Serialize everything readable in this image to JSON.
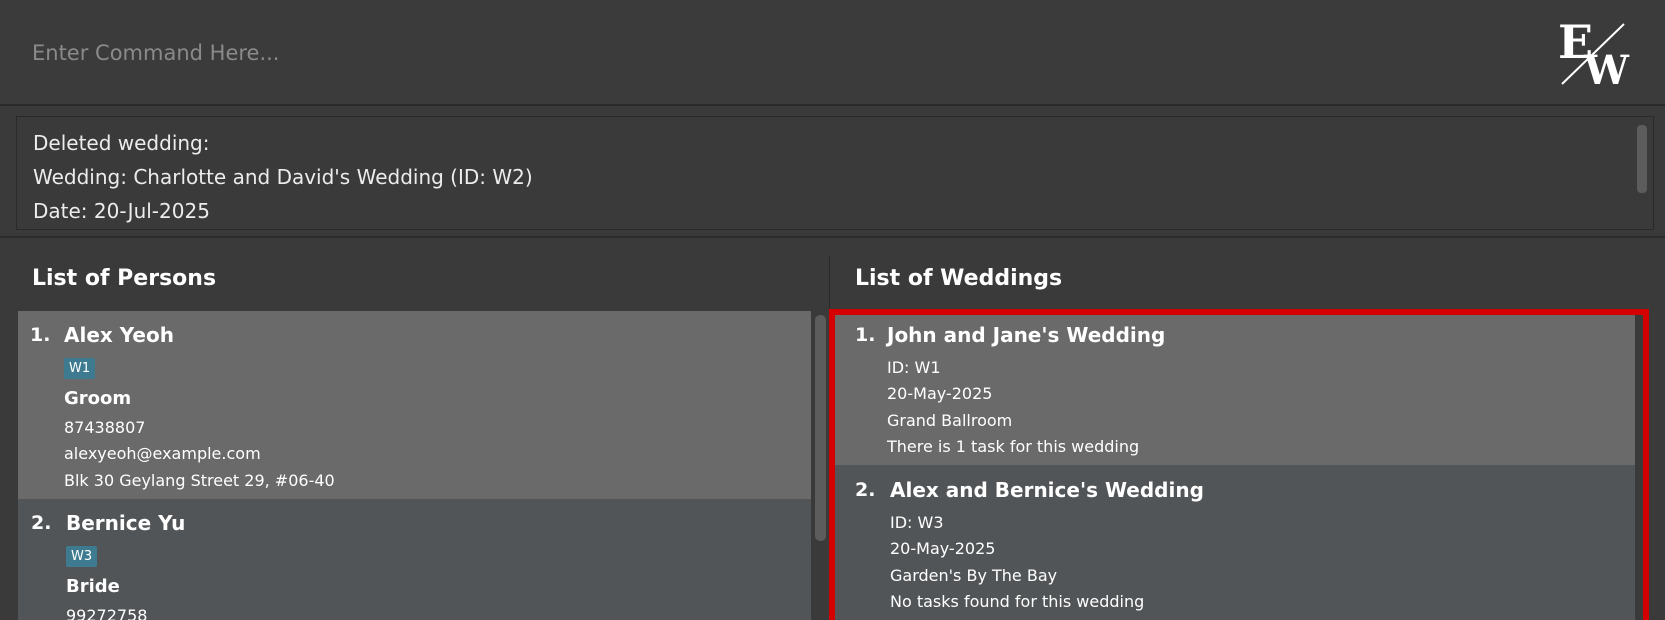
{
  "command": {
    "placeholder": "Enter Command Here..."
  },
  "logo": {
    "text": "EW"
  },
  "result": {
    "line1": "Deleted wedding:",
    "line2": "Wedding: Charlotte and David's Wedding (ID: W2)",
    "line3": "Date: 20-Jul-2025"
  },
  "persons": {
    "title": "List of Persons",
    "items": [
      {
        "index": "1.",
        "name": "Alex Yeoh",
        "tag": "W1",
        "role": "Groom",
        "phone": "87438807",
        "email": "alexyeoh@example.com",
        "address": "Blk 30 Geylang Street 29, #06-40"
      },
      {
        "index": "2.",
        "name": "Bernice Yu",
        "tag": "W3",
        "role": "Bride",
        "phone": "99272758"
      }
    ]
  },
  "weddings": {
    "title": "List of Weddings",
    "items": [
      {
        "index": "1.",
        "name": "John and Jane's Wedding",
        "id": "ID: W1",
        "date": "20-May-2025",
        "venue": "Grand Ballroom",
        "tasks": "There is 1 task for this wedding"
      },
      {
        "index": "2.",
        "name": "Alex and Bernice's Wedding",
        "id": "ID: W3",
        "date": "20-May-2025",
        "venue": "Garden's By The Bay",
        "tasks": "No tasks found for this wedding"
      }
    ]
  },
  "colors": {
    "highlight": "#d40000",
    "tag": "#3e7b91",
    "card_light": "#6a6a6a",
    "card_dark": "#525557"
  }
}
